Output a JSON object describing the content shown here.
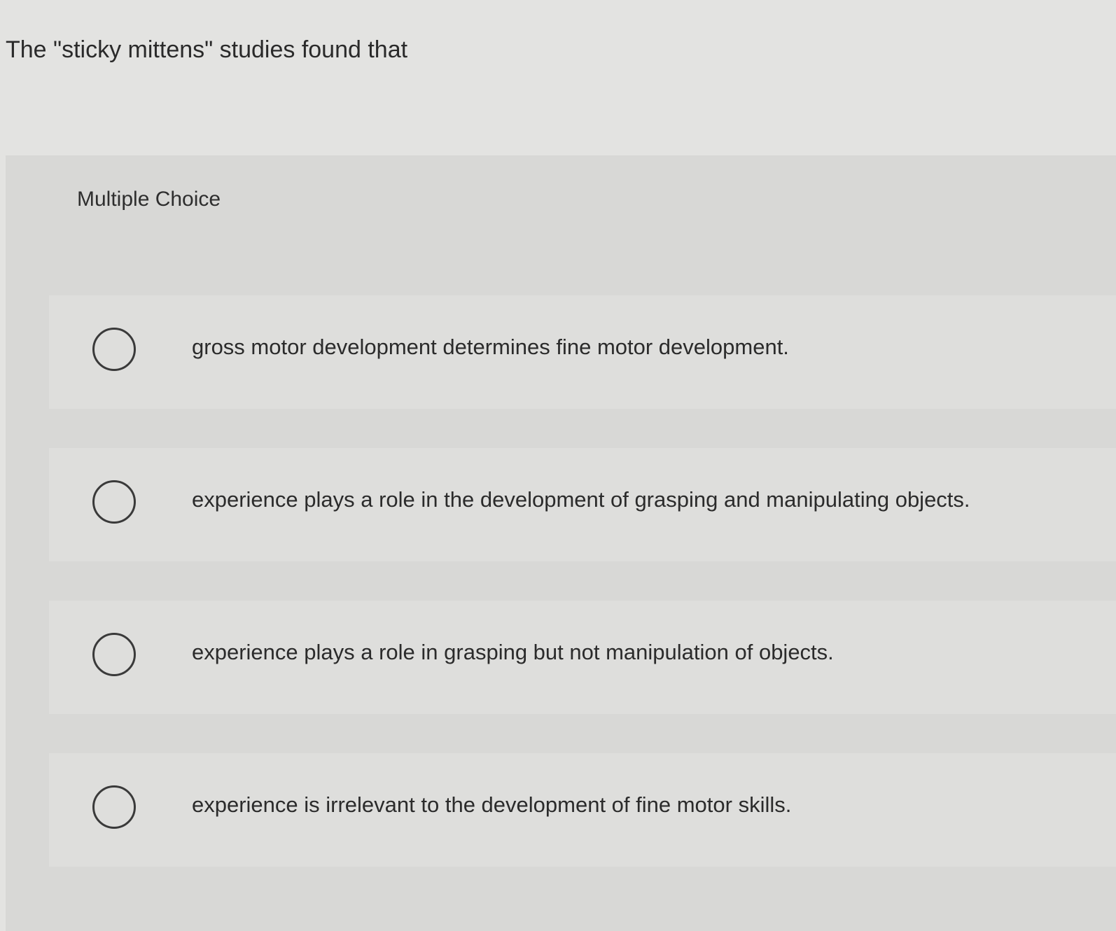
{
  "question": {
    "stem": "The \"sticky mittens\" studies found that"
  },
  "panel": {
    "heading": "Multiple Choice"
  },
  "options": [
    {
      "label": "gross motor development determines fine motor development.",
      "selected": false
    },
    {
      "label": "experience plays a role in the development of grasping and manipulating objects.",
      "selected": false
    },
    {
      "label": "experience plays a role in grasping but not manipulation of objects.",
      "selected": false
    },
    {
      "label": "experience is irrelevant to the development of fine motor skills.",
      "selected": false
    }
  ]
}
